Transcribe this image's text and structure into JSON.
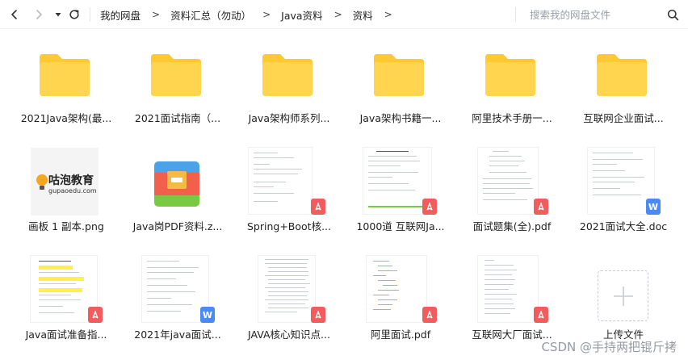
{
  "toolbar": {
    "back_label": "Back",
    "forward_label": "Forward",
    "history_label": "History",
    "refresh_label": "Refresh"
  },
  "breadcrumb": {
    "items": [
      "我的网盘",
      "资料汇总（勿动）",
      "Java资料",
      "资料"
    ],
    "separator": ">"
  },
  "search": {
    "placeholder": "搜索我的网盘文件",
    "value": ""
  },
  "files": [
    {
      "name": "2021Java架构(最...",
      "type": "folder"
    },
    {
      "name": "2021面试指南（...",
      "type": "folder"
    },
    {
      "name": "Java架构师系列...",
      "type": "folder"
    },
    {
      "name": "Java架构书籍一...",
      "type": "folder"
    },
    {
      "name": "阿里技术手册一...",
      "type": "folder"
    },
    {
      "name": "互联网企业面试...",
      "type": "folder"
    },
    {
      "name": "画板 1 副本.png",
      "type": "image",
      "logo_text": "咕泡教育",
      "logo_sub": "gupaoedu.com"
    },
    {
      "name": "Java岗PDF资料.z...",
      "type": "archive"
    },
    {
      "name": "Spring+Boot核...",
      "type": "pdf"
    },
    {
      "name": "1000道 互联网Ja...",
      "type": "pdf"
    },
    {
      "name": "面试题集(全).pdf",
      "type": "pdf"
    },
    {
      "name": "2021面试大全.doc",
      "type": "doc"
    },
    {
      "name": "Java面试准备指...",
      "type": "pdf"
    },
    {
      "name": "2021年java面试...",
      "type": "doc"
    },
    {
      "name": "JAVA核心知识点...",
      "type": "pdf"
    },
    {
      "name": "阿里面试.pdf",
      "type": "pdf"
    },
    {
      "name": "互联网大厂面试...",
      "type": "pdf"
    },
    {
      "name": "上传文件",
      "type": "upload"
    }
  ],
  "watermark": "CSDN @手持两把锟斤拷",
  "colors": {
    "folder": "#ffd54f",
    "folder_tab": "#ffc933",
    "pdf_badge": "#f25c5c",
    "doc_badge": "#4a8af4",
    "archive_top": "#4aa3e8",
    "archive_bottom": "#7ac943",
    "archive_mid": "#f2604c",
    "archive_clip": "#f5b945"
  },
  "icons": {
    "back": "chevron-left-icon",
    "forward": "chevron-right-icon",
    "history": "caret-down-icon",
    "refresh": "refresh-icon",
    "search": "search-icon",
    "pdf": "pdf-badge-icon",
    "doc": "word-badge-icon",
    "upload": "plus-icon"
  }
}
